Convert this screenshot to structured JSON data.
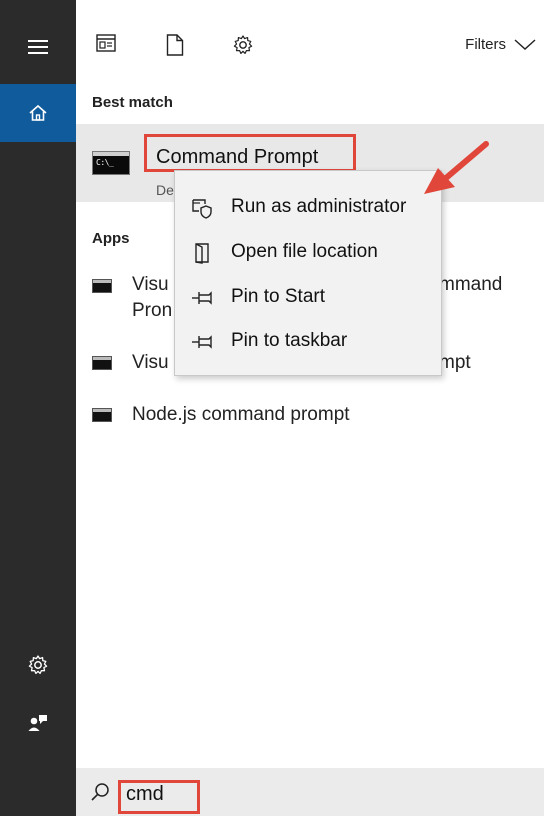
{
  "sidebar": {
    "items": [
      {
        "name": "menu",
        "icon": "hamburger-icon"
      },
      {
        "name": "home",
        "icon": "home-icon",
        "active": true
      },
      {
        "name": "settings",
        "icon": "gear-icon"
      },
      {
        "name": "feedback",
        "icon": "feedback-icon"
      }
    ]
  },
  "toolbar": {
    "icons": [
      "app-filter-icon",
      "document-filter-icon",
      "settings-filter-icon"
    ],
    "filters_label": "Filters"
  },
  "best_match": {
    "heading": "Best match",
    "title": "Command Prompt",
    "subtitle": "De",
    "icon": "command-prompt-icon"
  },
  "apps": {
    "heading": "Apps",
    "items": [
      {
        "line1_left": "Visu",
        "line1_right": "mmand",
        "line2": "Pron"
      },
      {
        "line1_left": "Visu",
        "line1_right": "mpt"
      },
      {
        "line1": "Node.js command prompt"
      }
    ]
  },
  "context_menu": {
    "items": [
      {
        "label": "Run as administrator",
        "icon": "shield-admin-icon"
      },
      {
        "label": "Open file location",
        "icon": "folder-door-icon"
      },
      {
        "label": "Pin to Start",
        "icon": "pin-icon"
      },
      {
        "label": "Pin to taskbar",
        "icon": "pin-icon"
      }
    ]
  },
  "search": {
    "value": "cmd",
    "icon": "search-icon"
  },
  "colors": {
    "rail": "#2b2b2b",
    "accent": "#0f5b9c",
    "highlight": "#e0463a"
  }
}
